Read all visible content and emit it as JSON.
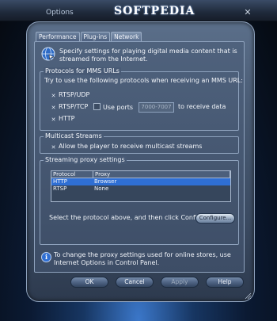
{
  "window": {
    "title": "Options",
    "watermark": "SOFTPEDIA",
    "close_glyph": "✕"
  },
  "tabs": [
    {
      "label": "Performance",
      "active": false
    },
    {
      "label": "Plug-ins",
      "active": false
    },
    {
      "label": "Network",
      "active": true
    }
  ],
  "intro": {
    "icon": "wmp-network-icon",
    "text": "Specify settings for playing digital media content that is streamed from the Internet."
  },
  "mms": {
    "legend": "Protocols for MMS URLs",
    "hint": "Try to use the following protocols when receiving an MMS URL:",
    "rtsp_udp": {
      "label": "RTSP/UDP",
      "checked": true
    },
    "rtsp_tcp": {
      "label": "RTSP/TCP",
      "checked": true
    },
    "use_ports": {
      "label": "Use ports",
      "checked": false,
      "value": "7000-7007",
      "suffix": "to receive data"
    },
    "http": {
      "label": "HTTP",
      "checked": true
    }
  },
  "multicast": {
    "legend": "Multicast Streams",
    "allow": {
      "label": "Allow the player to receive multicast streams",
      "checked": true
    }
  },
  "proxy": {
    "legend": "Streaming proxy settings",
    "columns": [
      "Protocol",
      "Proxy"
    ],
    "rows": [
      {
        "protocol": "HTTP",
        "proxy": "Browser",
        "selected": true
      },
      {
        "protocol": "RTSP",
        "proxy": "None",
        "selected": false
      }
    ],
    "instruction": "Select the protocol above, and then click Configure.",
    "configure_label": "Configure..."
  },
  "info": {
    "text": "To change the proxy settings used for online stores, use Internet Options in Control Panel."
  },
  "buttons": {
    "ok": "OK",
    "cancel": "Cancel",
    "apply": "Apply",
    "help": "Help"
  },
  "colors": {
    "accent": "#2f6fd4",
    "panel": "#485a75"
  }
}
